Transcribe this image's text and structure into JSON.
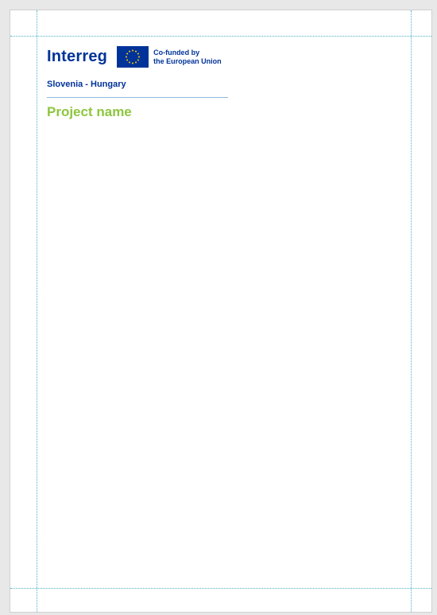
{
  "header": {
    "logo_word": "Interreg",
    "cofunded_line1": "Co-funded by",
    "cofunded_line2": "the European Union",
    "programme": "Slovenia - Hungary",
    "project_name": "Project name"
  },
  "colors": {
    "brand_blue": "#003399",
    "project_green": "#8dc63f",
    "divider": "#8fb8dc",
    "guides": "#4fb3c8"
  },
  "icons": [
    "eu-flag-icon"
  ]
}
